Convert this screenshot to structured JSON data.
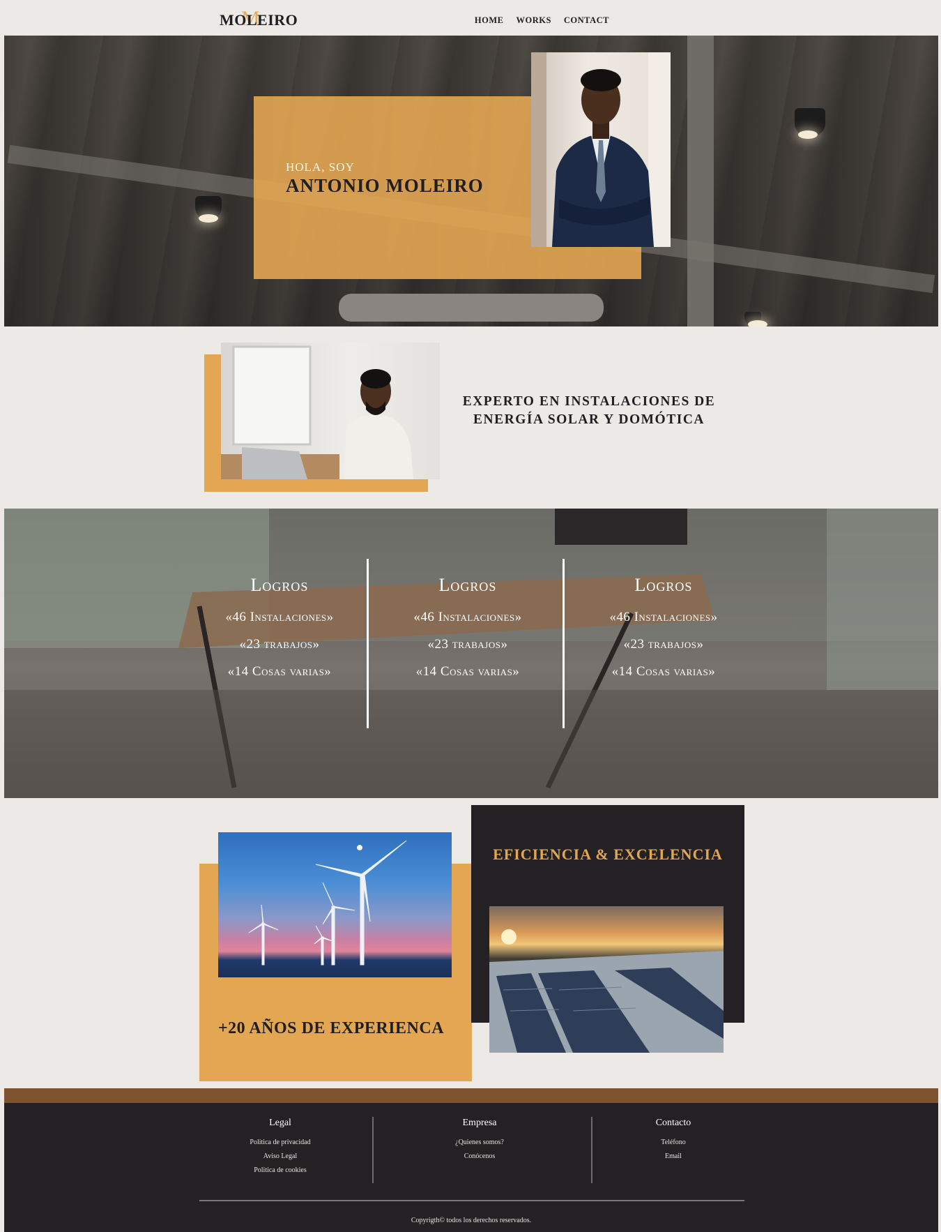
{
  "header": {
    "logo": "MOLEIRO",
    "logo_mark": "M",
    "nav": [
      "HOME",
      "WORKS",
      "CONTACT"
    ]
  },
  "hero": {
    "greeting": "HOLA, SOY",
    "name": "ANTONIO MOLEIRO"
  },
  "intro": {
    "title_line1": "EXPERTO EN INSTALACIONES DE",
    "title_line2": "ENERGÍA SOLAR Y DOMÓTICA"
  },
  "stats": {
    "columns": [
      {
        "heading": "Logros",
        "rows": [
          "«46 Instalaciones»",
          "«23 trabajos»",
          "«14 Cosas varias»"
        ]
      },
      {
        "heading": "Logros",
        "rows": [
          "«46 Instalaciones»",
          "«23 trabajos»",
          "«14 Cosas varias»"
        ]
      },
      {
        "heading": "Logros",
        "rows": [
          "«46 Instalaciones»",
          "«23 trabajos»",
          "«14 Cosas varias»"
        ]
      }
    ]
  },
  "experience": {
    "years_text": "+20 AÑOS DE EXPERIENCA",
    "quality_text": "EFICIENCIA & EXCELENCIA"
  },
  "footer": {
    "columns": [
      {
        "title": "Legal",
        "items": [
          "Politica de privacidad",
          "Aviso Legal",
          "Politica de cookies"
        ]
      },
      {
        "title": "Empresa",
        "items": [
          "¿Quienes somos?",
          "Conócenos"
        ]
      },
      {
        "title": "Contacto",
        "items": [
          "Teléfono",
          "Email"
        ]
      }
    ],
    "copyright": "Copyrigth© todos los derechos reservados."
  },
  "colors": {
    "accent": "#e3a652",
    "dark": "#232124",
    "band": "#7e5330",
    "background": "#ece9e6"
  }
}
